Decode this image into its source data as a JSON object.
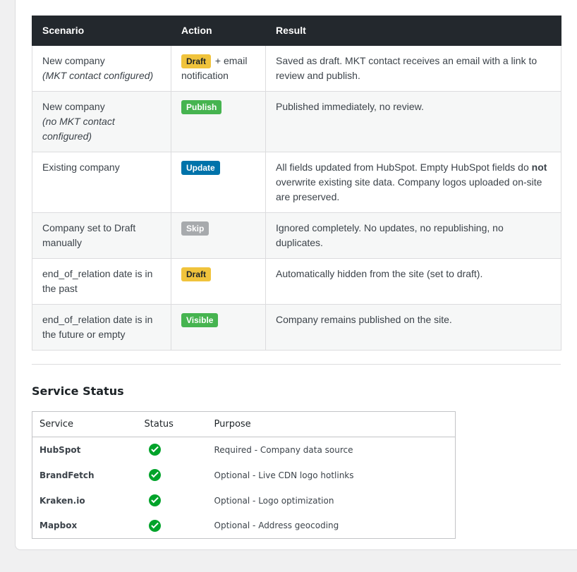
{
  "scenario_table": {
    "headers": [
      "Scenario",
      "Action",
      "Result"
    ],
    "rows": [
      {
        "scenario": "New company",
        "scenario_note": "(MKT contact configured)",
        "badge": "Draft",
        "badge_color": "#f0c33c",
        "action_suffix": "+ email notification",
        "result": "Saved as draft. MKT contact receives an email with a link to review and publish."
      },
      {
        "scenario": "New company",
        "scenario_note": "(no MKT contact configured)",
        "badge": "Publish",
        "badge_color": "#46b450",
        "result": "Published immediately, no review."
      },
      {
        "scenario": "Existing company",
        "badge": "Update",
        "badge_color": "#0073aa",
        "result_pre": "All fields updated from HubSpot. Empty HubSpot fields do",
        "result_bold": "not",
        "result_post": "overwrite existing site data. Company logos uploaded on-site are preserved."
      },
      {
        "scenario": "Company set to Draft manually",
        "badge": "Skip",
        "badge_color": "#a7aaad",
        "result": "Ignored completely. No updates, no republishing, no duplicates."
      },
      {
        "scenario": "end_of_relation date is in the past",
        "badge": "Draft",
        "badge_color": "#f0c33c",
        "result": "Automatically hidden from the site (set to draft)."
      },
      {
        "scenario": "end_of_relation date is in the future or empty",
        "badge": "Visible",
        "badge_color": "#46b450",
        "result": "Company remains published on the site."
      }
    ]
  },
  "service_status": {
    "title": "Service Status",
    "headers": [
      "Service",
      "Status",
      "Purpose"
    ],
    "status_icon": "check-circle-icon",
    "status_color": "#00a32a",
    "rows": [
      {
        "service": "HubSpot",
        "purpose": "Required - Company data source"
      },
      {
        "service": "BrandFetch",
        "purpose": "Optional - Live CDN logo hotlinks"
      },
      {
        "service": "Kraken.io",
        "purpose": "Optional - Logo optimization"
      },
      {
        "service": "Mapbox",
        "purpose": "Optional - Address geocoding"
      }
    ]
  }
}
